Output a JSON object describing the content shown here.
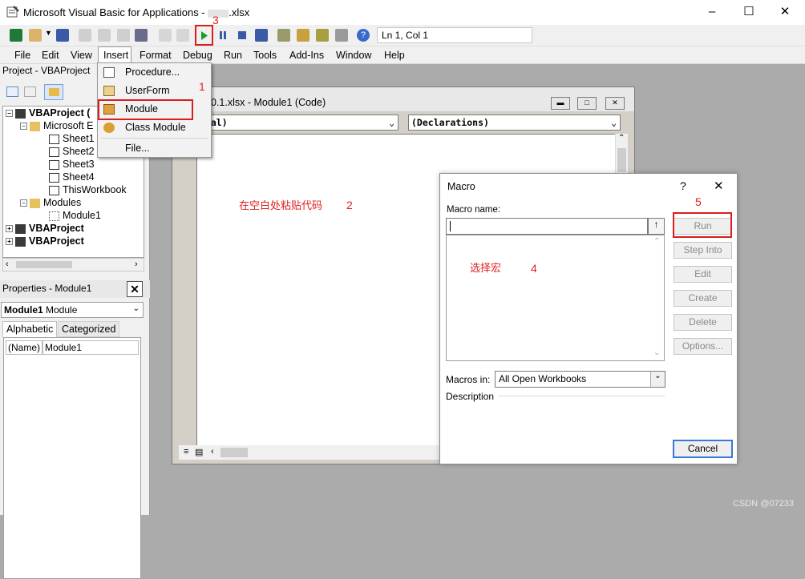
{
  "window": {
    "title": "Microsoft Visual Basic for Applications - ",
    "title_file": ".xlsx"
  },
  "toolbar": {
    "position": "Ln 1, Col 1"
  },
  "menu": [
    "File",
    "Edit",
    "View",
    "Insert",
    "Format",
    "Debug",
    "Run",
    "Tools",
    "Add-Ins",
    "Window",
    "Help"
  ],
  "insert_menu": [
    "Procedure...",
    "UserForm",
    "Module",
    "Class Module",
    "File..."
  ],
  "project": {
    "title": "Project - VBAProject",
    "items": [
      "VBAProject (",
      "Microsoft E",
      "Sheet1",
      "Sheet2",
      "Sheet3",
      "Sheet4",
      "ThisWorkbook",
      "Modules",
      "Module1",
      "VBAProject",
      "VBAProject"
    ]
  },
  "properties": {
    "title": "Properties - Module1",
    "object_name": "Module1",
    "object_type": "Module",
    "tabs": [
      "Alphabetic",
      "Categorized"
    ],
    "row_name": "(Name)",
    "row_value": "Module1"
  },
  "code_window": {
    "title": "0.1.xlsx - Module1 (Code)",
    "object_combo": "eral)",
    "proc_combo": "(Declarations)"
  },
  "macro_dialog": {
    "title": "Macro",
    "help": "?",
    "name_label": "Macro name:",
    "buttons": [
      "Run",
      "Step Into",
      "Edit",
      "Create",
      "Delete",
      "Options..."
    ],
    "macros_in_label": "Macros in:",
    "macros_in_value": "All Open Workbooks",
    "description_label": "Description",
    "cancel": "Cancel"
  },
  "annotations": {
    "n1": "1",
    "n2": "2",
    "n3": "3",
    "n4": "4",
    "n5": "5",
    "paste_code": "在空白处粘贴代码",
    "select_macro": "选择宏"
  },
  "watermark": "CSDN @07233"
}
